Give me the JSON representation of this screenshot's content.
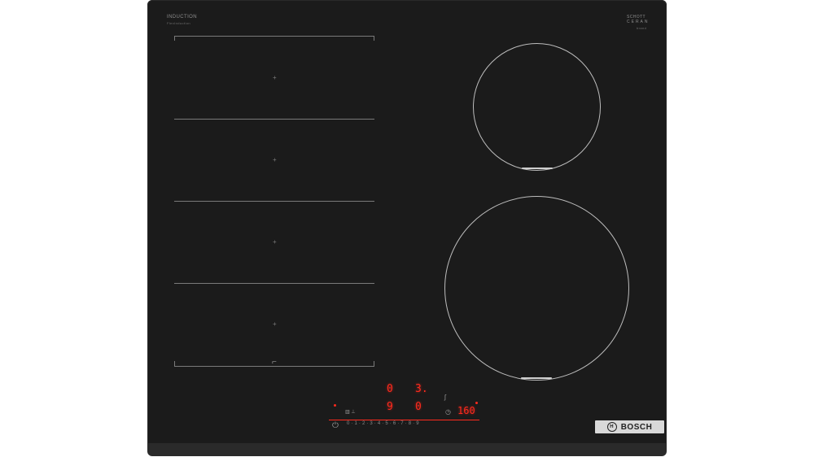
{
  "top_left_label": "INDUCTION",
  "top_left_sublabel": "FlexInduction",
  "top_right_label_line1": "SCHOTT",
  "top_right_label_line2": "CERAN",
  "top_right_sublabel": "brand",
  "zones": {
    "flex_cross": "+"
  },
  "controls": {
    "top_digit_1": "0",
    "top_digit_2": "3.",
    "mid_digit_1": "9",
    "mid_digit_2": "0",
    "temp": "160",
    "slider_scale": "0 · 1 · 2 · 3 · 4 · 5 · 6 · 7 · 8 · 9",
    "timer_icon": "timer-icon",
    "power_icon": "power-icon"
  },
  "brand": {
    "name": "BOSCH",
    "logo_glyph": "H"
  },
  "colors": {
    "hob_surface": "#1b1b1b",
    "display_red": "#ff2a1d",
    "ring_line": "#bdbdbd"
  }
}
